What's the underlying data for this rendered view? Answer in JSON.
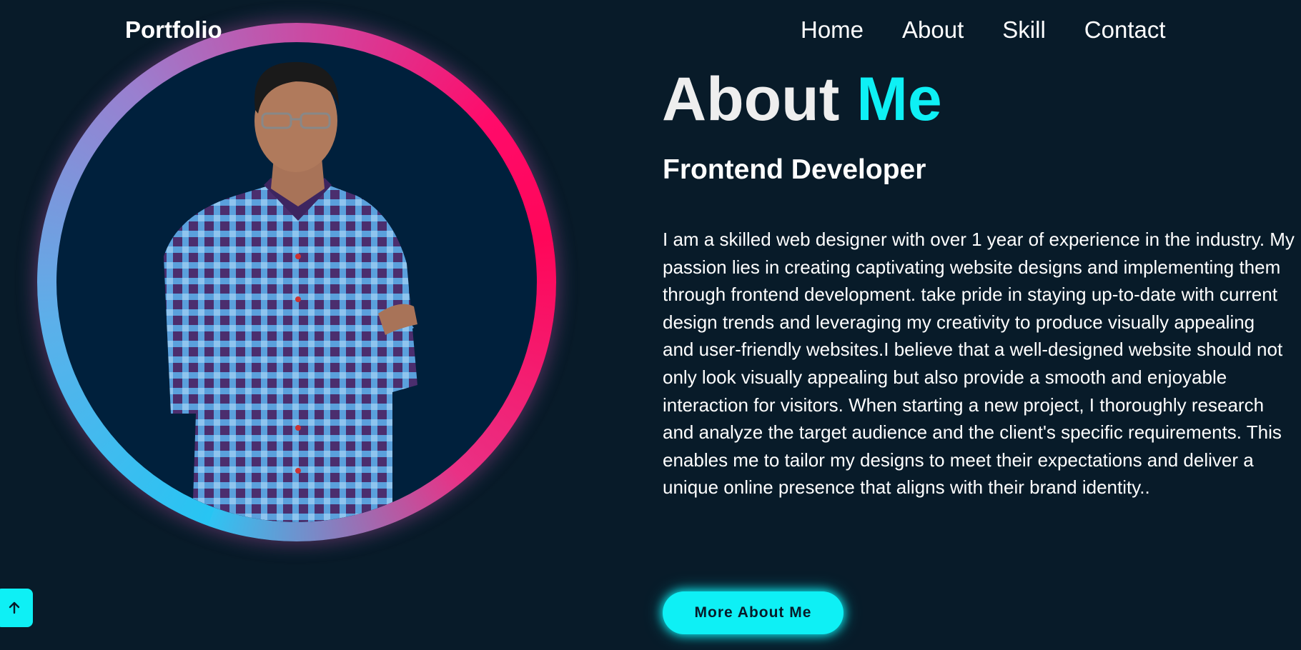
{
  "header": {
    "logo": "Portfolio",
    "nav": [
      {
        "label": "Home"
      },
      {
        "label": "About"
      },
      {
        "label": "Skill"
      },
      {
        "label": "Contact"
      }
    ]
  },
  "about": {
    "title_main": "About",
    "title_accent": "Me",
    "subtitle": "Frontend Developer",
    "bio": "I am a skilled web designer with over 1 year of experience in the industry. My passion lies in creating captivating website designs and implementing them through frontend development. take pride in staying up-to-date with current design trends and leveraging my creativity to produce visually appealing\nand user-friendly websites.I believe that a well-designed website should not only look visually appealing but also provide a smooth and enjoyable interaction for visitors. When starting a new project, I thoroughly research and analyze the target audience and the client's specific requirements. This enables me to tailor my designs to meet their expectations and deliver a unique online presence that aligns with their brand identity..",
    "button": "More About Me"
  },
  "icons": {
    "scroll_top": "arrow-up-icon"
  },
  "colors": {
    "background": "#081b29",
    "accent": "#0ef0f5",
    "ring_start": "#27c5f3",
    "ring_end": "#ff0659"
  }
}
